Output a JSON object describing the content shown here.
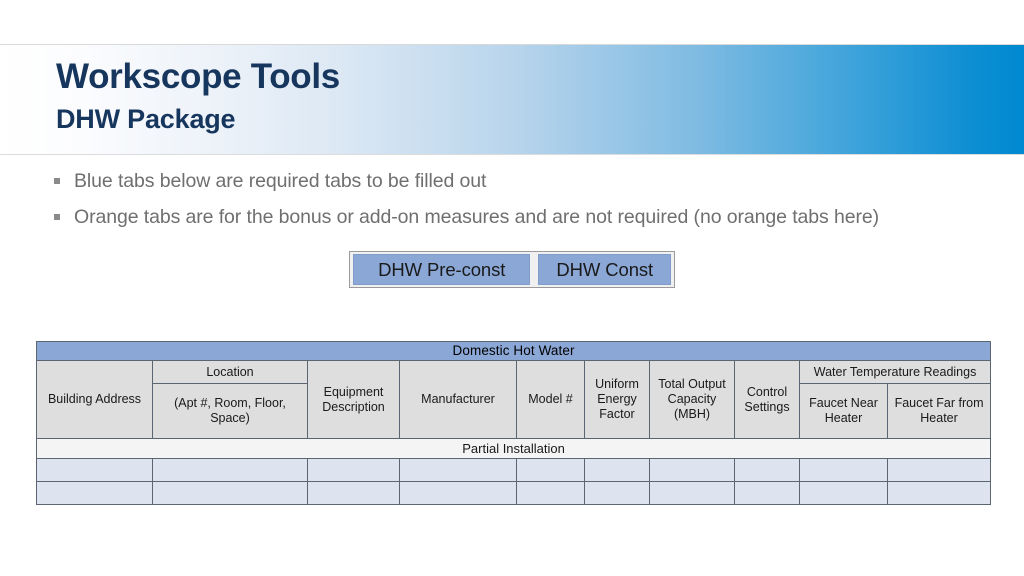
{
  "header": {
    "title": "Workscope Tools",
    "subtitle": "DHW Package",
    "gradient_start": "#ffffff",
    "gradient_end": "#0089d0",
    "title_color": "#17365d"
  },
  "bullets": [
    {
      "marker": "square-bullet",
      "text": "Blue tabs below are required tabs to be filled out"
    },
    {
      "marker": "square-bullet",
      "text": "Orange tabs are for the bonus or add-on measures and are not required (no orange tabs here)"
    }
  ],
  "tabs": {
    "tab_color": "#8ba7d6",
    "items": [
      {
        "label": "DHW Pre-const"
      },
      {
        "label": "DHW Const"
      }
    ]
  },
  "table": {
    "title": "Domestic Hot Water",
    "title_bar_color": "#8ba7d6",
    "header_cell_color": "#dedede",
    "data_row_color": "#dde3ef",
    "columns": [
      {
        "label": "Building Address"
      },
      {
        "label": "Location",
        "sub_label": "(Apt #, Room, Floor, Space)"
      },
      {
        "label": "Equipment Description"
      },
      {
        "label": "Manufacturer"
      },
      {
        "label": "Model #"
      },
      {
        "label": "Uniform Energy Factor"
      },
      {
        "label": "Total Output Capacity (MBH)"
      },
      {
        "label": "Control Settings"
      },
      {
        "label": "Water Temperature Readings",
        "sub_columns": [
          {
            "label": "Faucet Near Heater"
          },
          {
            "label": "Faucet Far from Heater"
          }
        ]
      }
    ],
    "section_row_label": "Partial Installation",
    "empty_data_rows": 2
  }
}
